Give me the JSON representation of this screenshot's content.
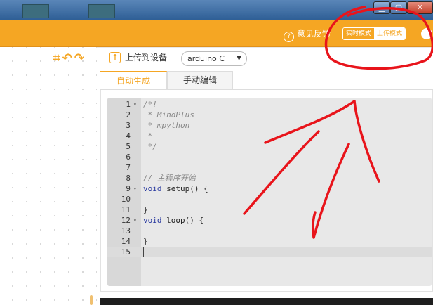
{
  "header": {
    "feedback_label": "意见反馈",
    "mode_realtime": "实时模式",
    "mode_upload": "上传模式"
  },
  "toolbar": {
    "upload_label": "上传到设备",
    "board_selected": "arduino C"
  },
  "tabs": [
    {
      "label": "自动生成",
      "active": true
    },
    {
      "label": "手动编辑",
      "active": false
    }
  ],
  "editor": {
    "lines": [
      {
        "num": "1",
        "fold": "▾",
        "text": "/*!"
      },
      {
        "num": "2",
        "fold": "",
        "text": " * MindPlus"
      },
      {
        "num": "3",
        "fold": "",
        "text": " * mpython"
      },
      {
        "num": "4",
        "fold": "",
        "text": " *"
      },
      {
        "num": "5",
        "fold": "",
        "text": " */"
      },
      {
        "num": "6",
        "fold": "",
        "text": ""
      },
      {
        "num": "7",
        "fold": "",
        "text": ""
      },
      {
        "num": "8",
        "fold": "",
        "text": "// 主程序开始"
      },
      {
        "num": "9",
        "fold": "▾",
        "kw": "void",
        "text": " setup() {"
      },
      {
        "num": "10",
        "fold": "",
        "text": ""
      },
      {
        "num": "11",
        "fold": "",
        "text": "}"
      },
      {
        "num": "12",
        "fold": "▾",
        "kw": "void",
        "text": " loop() {"
      },
      {
        "num": "13",
        "fold": "",
        "text": ""
      },
      {
        "num": "14",
        "fold": "",
        "text": "}"
      },
      {
        "num": "15",
        "fold": "",
        "text": ""
      }
    ]
  },
  "colors": {
    "accent": "#f5a623",
    "annotation": "#e8141b"
  }
}
